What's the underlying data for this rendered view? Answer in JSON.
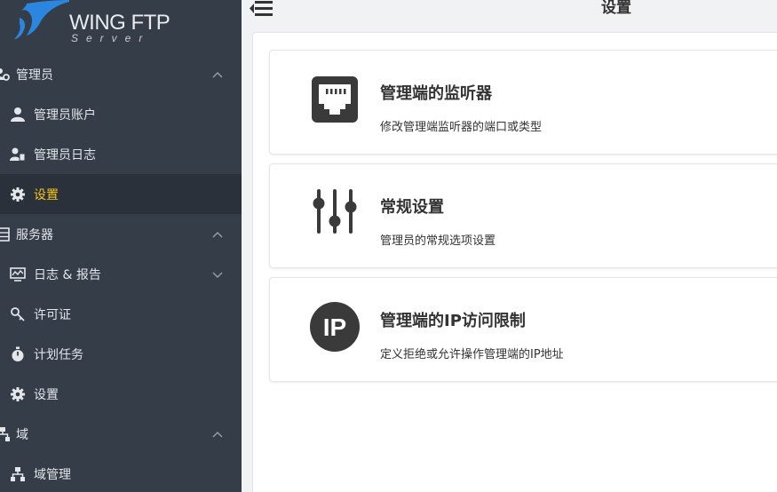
{
  "brand": {
    "name": "WING FTP",
    "subtitle": "Server"
  },
  "sidebar": {
    "items": [
      {
        "label": "管理员",
        "icon": "users-gear-icon",
        "type": "group",
        "expanded": true
      },
      {
        "label": "管理员账户",
        "icon": "user-icon",
        "type": "sub"
      },
      {
        "label": "管理员日志",
        "icon": "user-file-icon",
        "type": "sub"
      },
      {
        "label": "设置",
        "icon": "gear-icon",
        "type": "sub",
        "active": true
      },
      {
        "label": "服务器",
        "icon": "server-list-icon",
        "type": "group",
        "expanded": true
      },
      {
        "label": "日志 & 报告",
        "icon": "monitor-chart-icon",
        "type": "sub",
        "expandable": true
      },
      {
        "label": "许可证",
        "icon": "key-icon",
        "type": "sub"
      },
      {
        "label": "计划任务",
        "icon": "stopwatch-icon",
        "type": "sub"
      },
      {
        "label": "设置",
        "icon": "gear-icon",
        "type": "sub"
      },
      {
        "label": "域",
        "icon": "sitemap-icon",
        "type": "group",
        "expanded": true
      },
      {
        "label": "域管理",
        "icon": "sitemap-icon",
        "type": "sub"
      }
    ]
  },
  "header": {
    "title": "设置"
  },
  "cards": [
    {
      "title": "管理端的监听器",
      "description": "修改管理端监听器的端口或类型",
      "icon": "ethernet-port-icon"
    },
    {
      "title": "常规设置",
      "description": "管理员的常规选项设置",
      "icon": "sliders-icon"
    },
    {
      "title": "管理端的IP访问限制",
      "description": "定义拒绝或允许操作管理端的IP地址",
      "icon": "ip-badge-icon",
      "icon_text": "IP"
    }
  ],
  "colors": {
    "sidebar_bg": "#353d49",
    "sidebar_active_bg": "#2a313b",
    "active_text": "#f5c518",
    "icon_dark": "#3a3a3a"
  }
}
